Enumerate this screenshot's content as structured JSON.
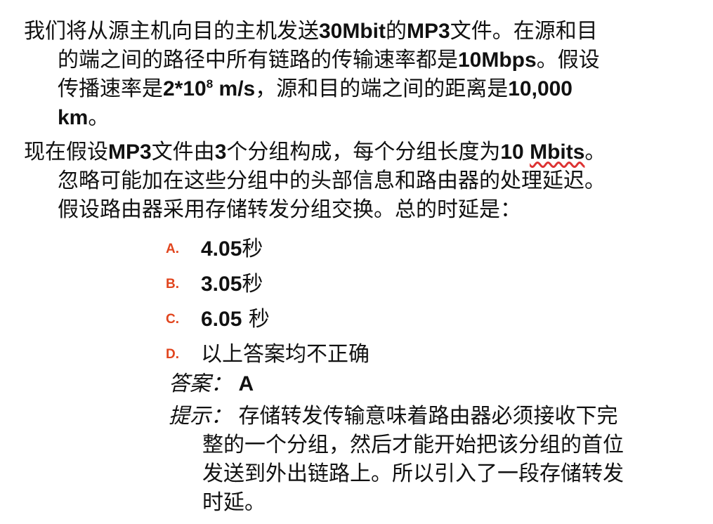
{
  "question": {
    "p1": {
      "l1_a": "我们将从源主机向目的主机发送",
      "l1_b": "30Mbit",
      "l1_c": "的",
      "l1_d": "MP3",
      "l1_e": "文件。在源和目",
      "l2_a": "的端之间的路径中所有链路的传输速率都是",
      "l2_b": "10Mbps",
      "l2_c": "。假设",
      "l3_a": "传播速率是",
      "l3_b": "2*10",
      "l3_sup": "8",
      "l3_c": " m/s",
      "l3_d": "，源和目的端之间的距离是",
      "l3_e": "10,000",
      "l4_a": "km",
      "l4_b": "。"
    },
    "p2": {
      "l1_a": "现在假设",
      "l1_b": "MP3",
      "l1_c": "文件由",
      "l1_d": "3",
      "l1_e": "个分组构成，每个分组长度为",
      "l1_f": "10 ",
      "l1_g": "Mbits",
      "l1_h": "。",
      "l2": "忽略可能加在这些分组中的头部信息和路由器的处理延迟。",
      "l3": "假设路由器采用存储转发分组交换。总的时延是："
    }
  },
  "options": [
    {
      "letter": "A.",
      "value": "4.05",
      "unit": "秒"
    },
    {
      "letter": "B.",
      "value": "3.05",
      "unit": "秒"
    },
    {
      "letter": "C.",
      "value": "6.05",
      "unit": " 秒"
    },
    {
      "letter": "D.",
      "value": "",
      "unit": "以上答案均不正确"
    }
  ],
  "answer": {
    "label": "答案：",
    "value": "A"
  },
  "hint": {
    "label": "提示：",
    "l1": " 存储转发传输意味着路由器必须接收下完",
    "l2": "整的一个分组，然后才能开始把该分组的首位",
    "l3": "发送到外出链路上。所以引入了一段存储转发",
    "l4": "时延。"
  },
  "colors": {
    "option_letter": "#e1451e",
    "text": "#111111",
    "background": "#ffffff",
    "spellcheck": "#dd3333"
  }
}
